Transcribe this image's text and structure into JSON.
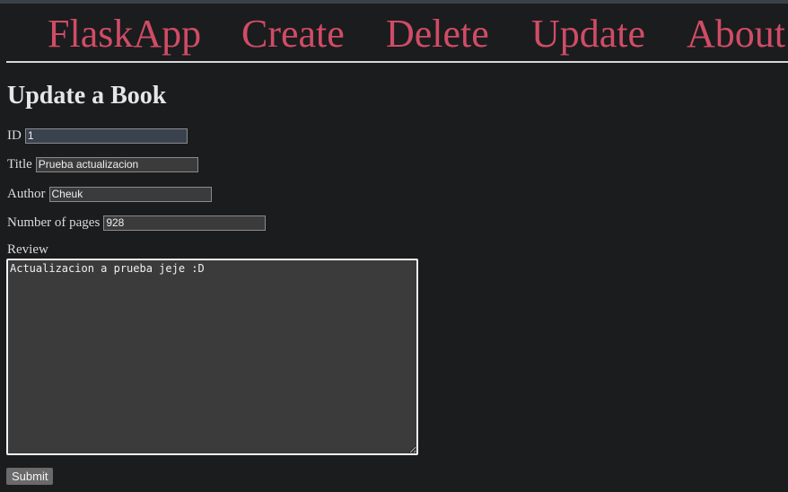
{
  "nav": {
    "brand": "FlaskApp",
    "items": [
      {
        "label": "Create"
      },
      {
        "label": "Delete"
      },
      {
        "label": "Update"
      },
      {
        "label": "About"
      }
    ]
  },
  "page": {
    "title": "Update a Book"
  },
  "form": {
    "id": {
      "label": "ID",
      "value": "1"
    },
    "title": {
      "label": "Title",
      "value": "Prueba actualizacion"
    },
    "author": {
      "label": "Author",
      "value": "Cheuk"
    },
    "pages": {
      "label": "Number of pages",
      "value": "928"
    },
    "review": {
      "label": "Review",
      "value": "Actualizacion a prueba jeje :D"
    },
    "submit_label": "Submit"
  },
  "colors": {
    "background": "#1b1c1e",
    "nav_link": "#d04c66",
    "text": "#e6e6e6"
  }
}
